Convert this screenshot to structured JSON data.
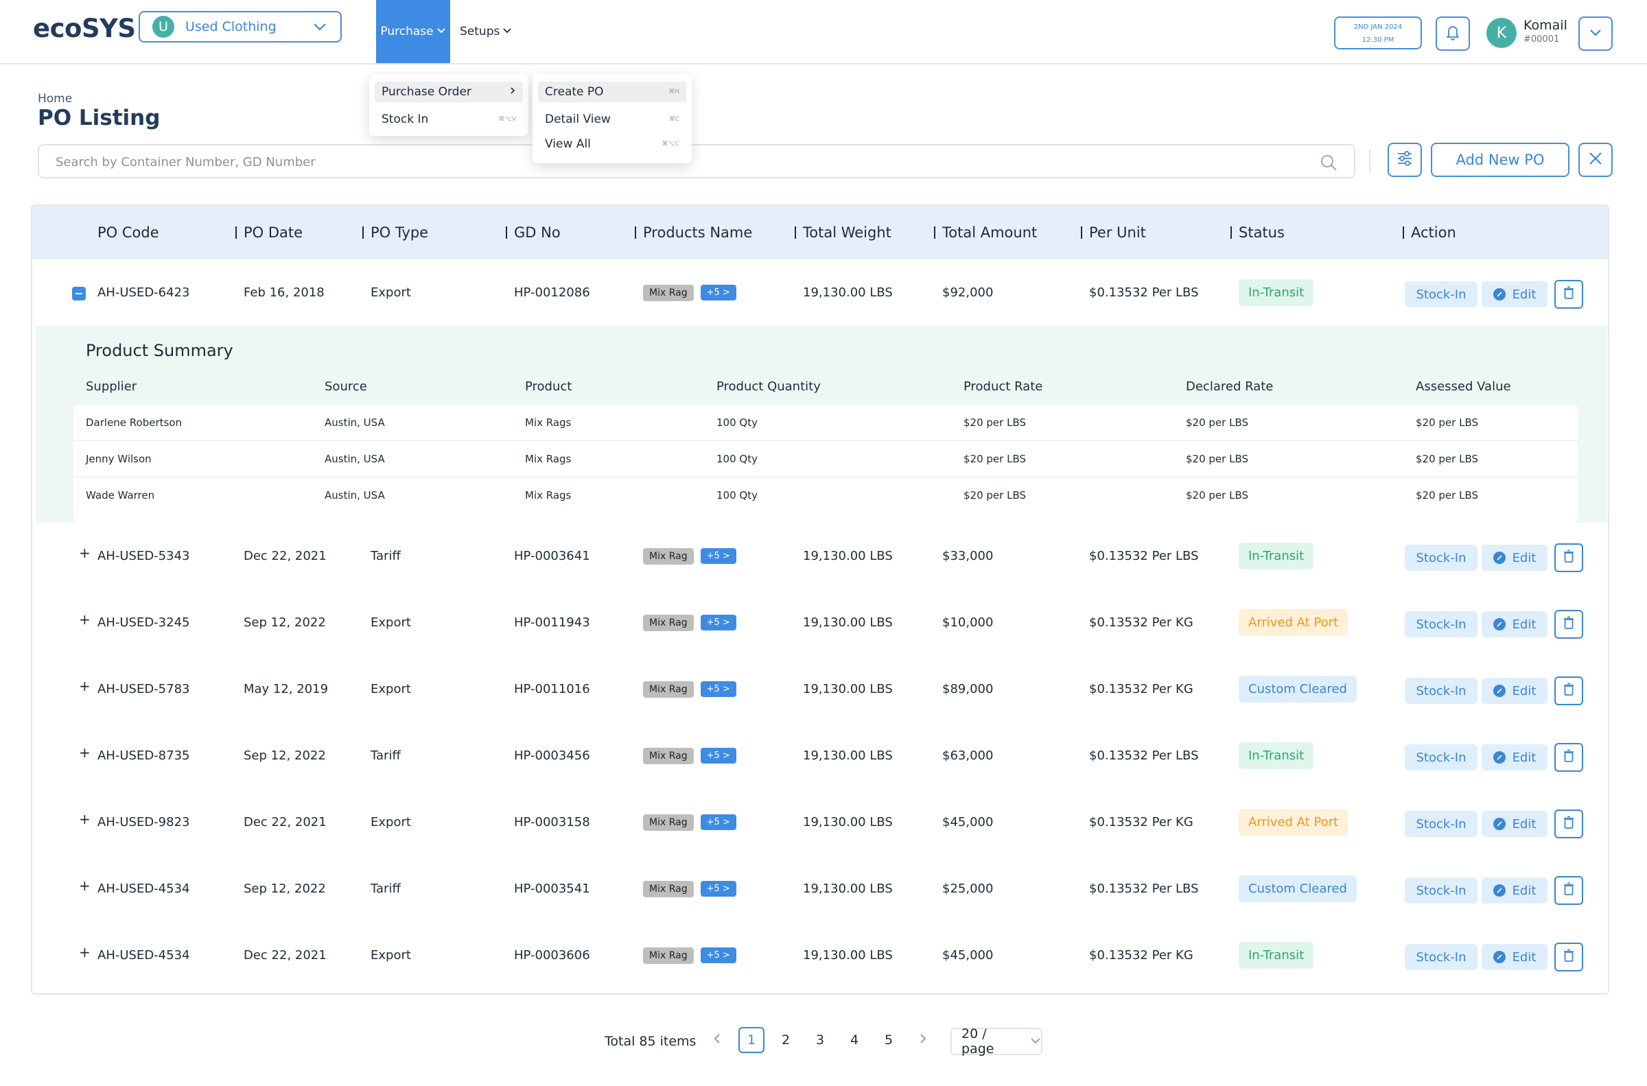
{
  "header": {
    "logo": "ecoSYS",
    "company": {
      "avatar": "U",
      "name": "Used Clothing"
    },
    "nav": {
      "purchase": "Purchase",
      "setups": "Setups"
    },
    "date": "2ND JAN 2024",
    "time": "12:30 PM",
    "user": {
      "avatar": "K",
      "name": "Komail",
      "id": "#00001"
    }
  },
  "page": {
    "breadcrumb": "Home",
    "title": "PO Listing"
  },
  "search": {
    "placeholder": "Search by Container Number, GD Number"
  },
  "actions": {
    "add": "Add New PO"
  },
  "menu": {
    "main": [
      {
        "label": "Purchase Order",
        "shortcut": ""
      },
      {
        "label": "Stock In",
        "shortcut": "⌘⌥V"
      }
    ],
    "sub": [
      {
        "label": "Create PO",
        "shortcut": "⌘H"
      },
      {
        "label": "Detail View",
        "shortcut": "⌘C"
      },
      {
        "label": "View All",
        "shortcut": "⌘⌥C"
      }
    ]
  },
  "table": {
    "headers": [
      "PO Code",
      "PO Date",
      "PO Type",
      "GD No",
      "Products Name",
      "Total Weight",
      "Total Amount",
      "Per Unit",
      "Status",
      "Action"
    ],
    "product_tag": "Mix Rag",
    "more_tag": "+5 >",
    "stock_label": "Stock-In",
    "edit_label": "Edit",
    "rows": [
      {
        "code": "AH-USED-6423",
        "date": "Feb 16,  2018",
        "type": "Export",
        "gd": "HP-0012086",
        "weight": "19,130.00 LBS",
        "amount": "$92,000",
        "unit": "$0.13532 Per LBS",
        "status": "In-Transit"
      },
      {
        "code": "AH-USED-5343",
        "date": "Dec 22, 2021",
        "type": "Tariff",
        "gd": "HP-0003641",
        "weight": "19,130.00 LBS",
        "amount": "$33,000",
        "unit": "$0.13532 Per LBS",
        "status": "In-Transit"
      },
      {
        "code": "AH-USED-3245",
        "date": "Sep 12,  2022",
        "type": "Export",
        "gd": "HP-0011943",
        "weight": "19,130.00 LBS",
        "amount": "$10,000",
        "unit": "$0.13532 Per KG",
        "status": "Arrived At Port"
      },
      {
        "code": "AH-USED-5783",
        "date": "May 12, 2019",
        "type": "Export",
        "gd": "HP-0011016",
        "weight": "19,130.00 LBS",
        "amount": "$89,000",
        "unit": "$0.13532 Per KG",
        "status": "Custom Cleared"
      },
      {
        "code": "AH-USED-8735",
        "date": "Sep 12,  2022",
        "type": "Tariff",
        "gd": "HP-0003456",
        "weight": "19,130.00 LBS",
        "amount": "$63,000",
        "unit": "$0.13532 Per LBS",
        "status": "In-Transit"
      },
      {
        "code": "AH-USED-9823",
        "date": "Dec 22, 2021",
        "type": "Export",
        "gd": "HP-0003158",
        "weight": "19,130.00 LBS",
        "amount": "$45,000",
        "unit": "$0.13532 Per KG",
        "status": "Arrived At Port"
      },
      {
        "code": "AH-USED-4534",
        "date": "Sep 12,  2022",
        "type": "Tariff",
        "gd": "HP-0003541",
        "weight": "19,130.00 LBS",
        "amount": "$25,000",
        "unit": "$0.13532 Per LBS",
        "status": "Custom Cleared"
      },
      {
        "code": "AH-USED-4534",
        "date": "Dec 22, 2021",
        "type": "Export",
        "gd": "HP-0003606",
        "weight": "19,130.00 LBS",
        "amount": "$45,000",
        "unit": "$0.13532 Per KG",
        "status": "In-Transit"
      }
    ]
  },
  "summary": {
    "title": "Product Summary",
    "headers": [
      "Supplier",
      "Source",
      "Product",
      "Product Quantity",
      "Product Rate",
      "Declared Rate",
      "Assessed Value"
    ],
    "rows": [
      {
        "supplier": "Darlene Robertson",
        "source": "Austin, USA",
        "product": "Mix Rags",
        "qty": "100 Qty",
        "rate": "$20 per LBS",
        "declared": "$20 per LBS",
        "assessed": "$20 per LBS"
      },
      {
        "supplier": "Jenny Wilson",
        "source": "Austin, USA",
        "product": "Mix Rags",
        "qty": "100 Qty",
        "rate": "$20 per LBS",
        "declared": "$20 per LBS",
        "assessed": "$20 per LBS"
      },
      {
        "supplier": "Wade Warren",
        "source": "Austin, USA",
        "product": "Mix Rags",
        "qty": "100 Qty",
        "rate": "$20 per LBS",
        "declared": "$20 per LBS",
        "assessed": "$20 per LBS"
      }
    ]
  },
  "pagination": {
    "total": "Total 85 items",
    "pages": [
      "1",
      "2",
      "3",
      "4",
      "5"
    ],
    "current": "1",
    "page_size": "20 / page"
  },
  "colors": {
    "primary": "#3e8be4",
    "in_transit": "#2ba56e",
    "arrived": "#eb9826",
    "custom": "#3a86d6"
  }
}
